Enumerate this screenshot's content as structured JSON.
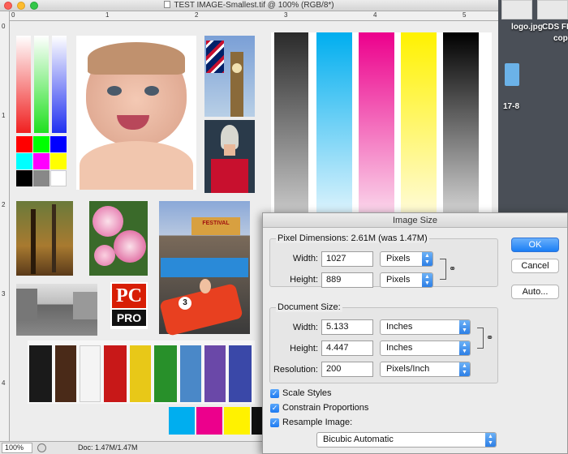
{
  "window": {
    "title": "TEST IMAGE-Smallest.tif @ 100% (RGB/8*)",
    "status_zoom": "100%",
    "status_doc": "Doc: 1.47M/1.47M"
  },
  "rulers": {
    "h": [
      "0",
      "1",
      "2",
      "3",
      "4",
      "5"
    ],
    "v": [
      "0",
      "1",
      "2",
      "3",
      "4"
    ]
  },
  "desktop": {
    "file1": "logo.jpg",
    "file2": "CDS FIN",
    "file2b": "cop",
    "folder_label": "17-8"
  },
  "canvas": {
    "pc_pro_top": "PC",
    "pc_pro_bottom": "PRO",
    "ride_number": "3",
    "fair_sign": "FESTIVAL"
  },
  "dialog": {
    "title": "Image Size",
    "pixel_dimensions_label": "Pixel Dimensions:",
    "pixel_dimensions_value": "2.61M (was 1.47M)",
    "width_label": "Width:",
    "width_value": "1027",
    "width_unit": "Pixels",
    "height_label": "Height:",
    "height_value": "889",
    "height_unit": "Pixels",
    "document_size_label": "Document Size:",
    "doc_width_label": "Width:",
    "doc_width_value": "5.133",
    "doc_width_unit": "Inches",
    "doc_height_label": "Height:",
    "doc_height_value": "4.447",
    "doc_height_unit": "Inches",
    "resolution_label": "Resolution:",
    "resolution_value": "200",
    "resolution_unit": "Pixels/Inch",
    "ok_label": "OK",
    "cancel_label": "Cancel",
    "auto_label": "Auto...",
    "scale_styles": "Scale Styles",
    "constrain_proportions": "Constrain Proportions",
    "resample_image": "Resample Image:",
    "resample_method": "Bicubic Automatic"
  },
  "colors": {
    "cyan": "#00aeef",
    "magenta": "#ec008c",
    "yellow": "#fff200",
    "ok_blue": "#1b7ef5"
  }
}
